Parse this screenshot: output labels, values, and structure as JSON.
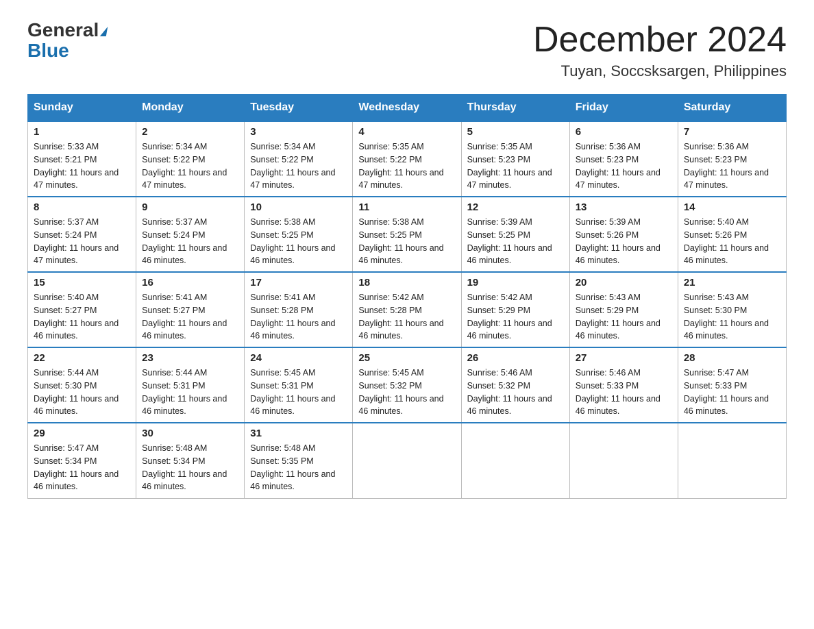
{
  "header": {
    "logo_top": "General",
    "logo_bottom": "Blue",
    "month_title": "December 2024",
    "subtitle": "Tuyan, Soccsksargen, Philippines"
  },
  "weekdays": [
    "Sunday",
    "Monday",
    "Tuesday",
    "Wednesday",
    "Thursday",
    "Friday",
    "Saturday"
  ],
  "weeks": [
    [
      {
        "day": "1",
        "sunrise": "5:33 AM",
        "sunset": "5:21 PM",
        "daylight": "11 hours and 47 minutes."
      },
      {
        "day": "2",
        "sunrise": "5:34 AM",
        "sunset": "5:22 PM",
        "daylight": "11 hours and 47 minutes."
      },
      {
        "day": "3",
        "sunrise": "5:34 AM",
        "sunset": "5:22 PM",
        "daylight": "11 hours and 47 minutes."
      },
      {
        "day": "4",
        "sunrise": "5:35 AM",
        "sunset": "5:22 PM",
        "daylight": "11 hours and 47 minutes."
      },
      {
        "day": "5",
        "sunrise": "5:35 AM",
        "sunset": "5:23 PM",
        "daylight": "11 hours and 47 minutes."
      },
      {
        "day": "6",
        "sunrise": "5:36 AM",
        "sunset": "5:23 PM",
        "daylight": "11 hours and 47 minutes."
      },
      {
        "day": "7",
        "sunrise": "5:36 AM",
        "sunset": "5:23 PM",
        "daylight": "11 hours and 47 minutes."
      }
    ],
    [
      {
        "day": "8",
        "sunrise": "5:37 AM",
        "sunset": "5:24 PM",
        "daylight": "11 hours and 47 minutes."
      },
      {
        "day": "9",
        "sunrise": "5:37 AM",
        "sunset": "5:24 PM",
        "daylight": "11 hours and 46 minutes."
      },
      {
        "day": "10",
        "sunrise": "5:38 AM",
        "sunset": "5:25 PM",
        "daylight": "11 hours and 46 minutes."
      },
      {
        "day": "11",
        "sunrise": "5:38 AM",
        "sunset": "5:25 PM",
        "daylight": "11 hours and 46 minutes."
      },
      {
        "day": "12",
        "sunrise": "5:39 AM",
        "sunset": "5:25 PM",
        "daylight": "11 hours and 46 minutes."
      },
      {
        "day": "13",
        "sunrise": "5:39 AM",
        "sunset": "5:26 PM",
        "daylight": "11 hours and 46 minutes."
      },
      {
        "day": "14",
        "sunrise": "5:40 AM",
        "sunset": "5:26 PM",
        "daylight": "11 hours and 46 minutes."
      }
    ],
    [
      {
        "day": "15",
        "sunrise": "5:40 AM",
        "sunset": "5:27 PM",
        "daylight": "11 hours and 46 minutes."
      },
      {
        "day": "16",
        "sunrise": "5:41 AM",
        "sunset": "5:27 PM",
        "daylight": "11 hours and 46 minutes."
      },
      {
        "day": "17",
        "sunrise": "5:41 AM",
        "sunset": "5:28 PM",
        "daylight": "11 hours and 46 minutes."
      },
      {
        "day": "18",
        "sunrise": "5:42 AM",
        "sunset": "5:28 PM",
        "daylight": "11 hours and 46 minutes."
      },
      {
        "day": "19",
        "sunrise": "5:42 AM",
        "sunset": "5:29 PM",
        "daylight": "11 hours and 46 minutes."
      },
      {
        "day": "20",
        "sunrise": "5:43 AM",
        "sunset": "5:29 PM",
        "daylight": "11 hours and 46 minutes."
      },
      {
        "day": "21",
        "sunrise": "5:43 AM",
        "sunset": "5:30 PM",
        "daylight": "11 hours and 46 minutes."
      }
    ],
    [
      {
        "day": "22",
        "sunrise": "5:44 AM",
        "sunset": "5:30 PM",
        "daylight": "11 hours and 46 minutes."
      },
      {
        "day": "23",
        "sunrise": "5:44 AM",
        "sunset": "5:31 PM",
        "daylight": "11 hours and 46 minutes."
      },
      {
        "day": "24",
        "sunrise": "5:45 AM",
        "sunset": "5:31 PM",
        "daylight": "11 hours and 46 minutes."
      },
      {
        "day": "25",
        "sunrise": "5:45 AM",
        "sunset": "5:32 PM",
        "daylight": "11 hours and 46 minutes."
      },
      {
        "day": "26",
        "sunrise": "5:46 AM",
        "sunset": "5:32 PM",
        "daylight": "11 hours and 46 minutes."
      },
      {
        "day": "27",
        "sunrise": "5:46 AM",
        "sunset": "5:33 PM",
        "daylight": "11 hours and 46 minutes."
      },
      {
        "day": "28",
        "sunrise": "5:47 AM",
        "sunset": "5:33 PM",
        "daylight": "11 hours and 46 minutes."
      }
    ],
    [
      {
        "day": "29",
        "sunrise": "5:47 AM",
        "sunset": "5:34 PM",
        "daylight": "11 hours and 46 minutes."
      },
      {
        "day": "30",
        "sunrise": "5:48 AM",
        "sunset": "5:34 PM",
        "daylight": "11 hours and 46 minutes."
      },
      {
        "day": "31",
        "sunrise": "5:48 AM",
        "sunset": "5:35 PM",
        "daylight": "11 hours and 46 minutes."
      },
      null,
      null,
      null,
      null
    ]
  ]
}
